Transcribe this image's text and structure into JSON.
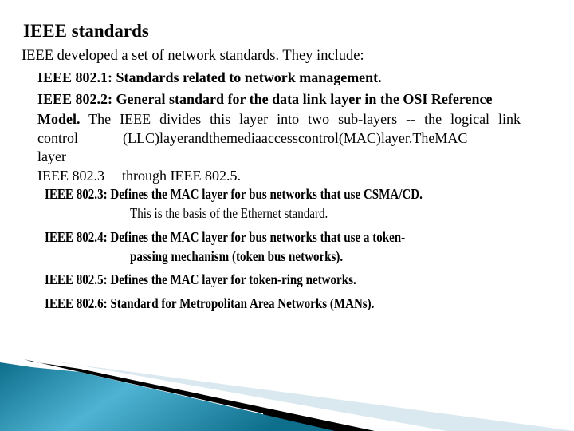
{
  "slide": {
    "title": "IEEE standards",
    "intro": "IEEE developed a set of network standards. They include:",
    "items": {
      "i8021": {
        "label": "IEEE 802.1:",
        "text": " Standards related to network management."
      },
      "i8022": {
        "line1": "IEEE 802.2: General standard for the data link layer in the OSI Reference",
        "line2_bold": "Model.",
        "line2_rest": " The IEEE divides this layer into two sub-layers -- the logical link",
        "line3_a": "control",
        "line3_b": "(LLC)layerandthemediaaccesscontrol(MAC)layer.TheMAC",
        "line4": "layer",
        "line5_a": "IEEE 802.3",
        "line5_b": "through  IEEE 802.5."
      },
      "i8023": {
        "line1": "IEEE 802.3: Defines the MAC layer for bus networks that use CSMA/CD.",
        "line2": "This is the basis of the Ethernet standard."
      },
      "i8024": {
        "line1": "IEEE 802.4: Defines the MAC layer for bus networks that use a token-",
        "line2": "passing mechanism (token bus networks)."
      },
      "i8025": {
        "line1": "IEEE 802.5: Defines the MAC layer for token-ring networks."
      },
      "i8026": {
        "line1": "IEEE 802.6: Standard for Metropolitan Area Networks (MANs)."
      }
    }
  },
  "theme": {
    "accent_dark": "#0e6f8c",
    "accent_light": "#4fb3d3",
    "stripe_light": "#d9e9ef"
  }
}
